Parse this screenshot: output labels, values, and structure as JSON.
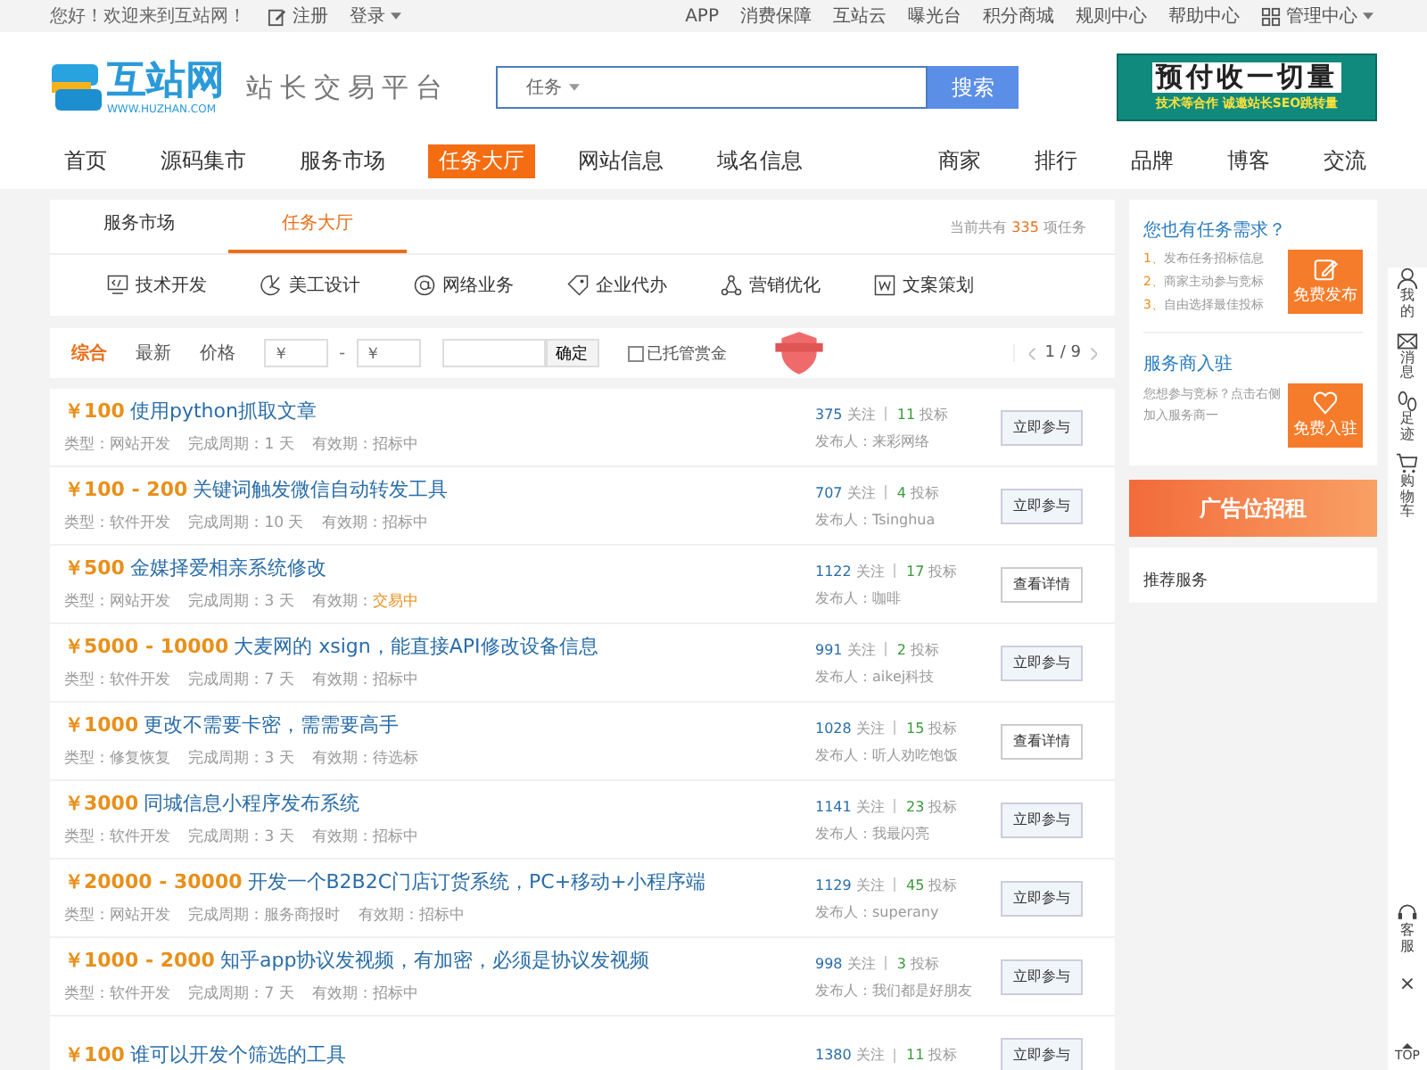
{
  "topbar": {
    "greeting": "您好！欢迎来到互站网！",
    "register": "注册",
    "login": "登录",
    "links": [
      "APP",
      "消费保障",
      "互站云",
      "曝光台",
      "积分商城",
      "规则中心",
      "帮助中心"
    ],
    "admin": "管理中心"
  },
  "header": {
    "logo": "互站网",
    "logo_url": "WWW.HUZHAN.COM",
    "slogan": "站长交易平台",
    "search_category": "任务",
    "search_button": "搜索",
    "ad_title": "预付收一切量",
    "ad_subtitle": "技术等合作 诚邀站长SEO跳转量"
  },
  "nav": {
    "left": [
      {
        "label": "首页",
        "selected": false
      },
      {
        "label": "源码集市",
        "selected": false
      },
      {
        "label": "服务市场",
        "selected": false
      },
      {
        "label": "任务大厅",
        "selected": true
      },
      {
        "label": "网站信息",
        "selected": false
      },
      {
        "label": "域名信息",
        "selected": false
      }
    ],
    "right": [
      "商家",
      "排行",
      "品牌",
      "博客",
      "交流"
    ]
  },
  "tabs": [
    {
      "label": "服务市场",
      "selected": false
    },
    {
      "label": "任务大厅",
      "selected": true
    }
  ],
  "count": {
    "prefix": "当前共有",
    "value": "335",
    "suffix": "项任务"
  },
  "categories": [
    {
      "label": "技术开发"
    },
    {
      "label": "美工设计"
    },
    {
      "label": "网络业务"
    },
    {
      "label": "企业代办"
    },
    {
      "label": "营销优化"
    },
    {
      "label": "文案策划"
    }
  ],
  "filter": {
    "sorts": [
      {
        "label": "综合",
        "selected": true
      },
      {
        "label": "最新",
        "selected": false
      },
      {
        "label": "价格",
        "selected": false
      }
    ],
    "min_placeholder": "￥",
    "dash": "-",
    "max_placeholder": "￥",
    "confirm": "确定",
    "escrow": {
      "label": "已托管赏金",
      "checked": false
    },
    "page": "1 / 9"
  },
  "tasks": [
    {
      "price": "￥100",
      "title": "使用python抓取文章",
      "meta": [
        {
          "label": "类型：网站开发"
        },
        {
          "label": "完成周期：1 天"
        },
        {
          "label": "有效期：",
          "value": "招标中",
          "kind": "normal"
        }
      ],
      "follows": "375",
      "follows_label": "关注",
      "bids": "11",
      "bids_label": "投标",
      "publisher": "发布人：来彩网络",
      "button": {
        "label": "立即参与",
        "kind": "join"
      }
    },
    {
      "price": "￥100 - 200",
      "title": "关键词触发微信自动转发工具",
      "meta": [
        {
          "label": "类型：软件开发"
        },
        {
          "label": "完成周期：10 天"
        },
        {
          "label": "有效期：",
          "value": "招标中",
          "kind": "normal"
        }
      ],
      "follows": "707",
      "follows_label": "关注",
      "bids": "4",
      "bids_label": "投标",
      "publisher": "发布人：Tsinghua",
      "button": {
        "label": "立即参与",
        "kind": "join"
      }
    },
    {
      "price": "￥500",
      "title": "金媒择爱相亲系统修改",
      "meta": [
        {
          "label": "类型：网站开发"
        },
        {
          "label": "完成周期：3 天"
        },
        {
          "label": "有效期：",
          "value": "交易中",
          "kind": "trading"
        }
      ],
      "follows": "1122",
      "follows_label": "关注",
      "bids": "17",
      "bids_label": "投标",
      "publisher": "发布人：咖啡",
      "button": {
        "label": "查看详情",
        "kind": "view"
      }
    },
    {
      "price": "￥5000 - 10000",
      "title": "大麦网的 xsign，能直接API修改设备信息",
      "meta": [
        {
          "label": "类型：软件开发"
        },
        {
          "label": "完成周期：7 天"
        },
        {
          "label": "有效期：",
          "value": "招标中",
          "kind": "normal"
        }
      ],
      "follows": "991",
      "follows_label": "关注",
      "bids": "2",
      "bids_label": "投标",
      "publisher": "发布人：aikej科技",
      "button": {
        "label": "立即参与",
        "kind": "join"
      }
    },
    {
      "price": "￥1000",
      "title": "更改不需要卡密，需需要高手",
      "meta": [
        {
          "label": "类型：修复恢复"
        },
        {
          "label": "完成周期：3 天"
        },
        {
          "label": "有效期：",
          "value": "待选标",
          "kind": "normal"
        }
      ],
      "follows": "1028",
      "follows_label": "关注",
      "bids": "15",
      "bids_label": "投标",
      "publisher": "发布人：听人劝吃饱饭",
      "button": {
        "label": "查看详情",
        "kind": "view"
      }
    },
    {
      "price": "￥3000",
      "title": "同城信息小程序发布系统",
      "meta": [
        {
          "label": "类型：软件开发"
        },
        {
          "label": "完成周期：3 天"
        },
        {
          "label": "有效期：",
          "value": "招标中",
          "kind": "normal"
        }
      ],
      "follows": "1141",
      "follows_label": "关注",
      "bids": "23",
      "bids_label": "投标",
      "publisher": "发布人：我最闪亮",
      "button": {
        "label": "立即参与",
        "kind": "join"
      }
    },
    {
      "price": "￥20000 - 30000",
      "title": "开发一个B2B2C门店订货系统，PC+移动+小程序端",
      "meta": [
        {
          "label": "类型：网站开发"
        },
        {
          "label": "完成周期：服务商报时"
        },
        {
          "label": "有效期：",
          "value": "招标中",
          "kind": "normal"
        }
      ],
      "follows": "1129",
      "follows_label": "关注",
      "bids": "45",
      "bids_label": "投标",
      "publisher": "发布人：superany",
      "button": {
        "label": "立即参与",
        "kind": "join"
      }
    },
    {
      "price": "￥1000 - 2000",
      "title": "知乎app协议发视频，有加密，必须是协议发视频",
      "meta": [
        {
          "label": "类型：软件开发"
        },
        {
          "label": "完成周期：7 天"
        },
        {
          "label": "有效期：",
          "value": "招标中",
          "kind": "normal"
        }
      ],
      "follows": "998",
      "follows_label": "关注",
      "bids": "3",
      "bids_label": "投标",
      "publisher": "发布人：我们都是好朋友",
      "button": {
        "label": "立即参与",
        "kind": "join"
      }
    },
    {
      "price": "￥100",
      "title": "谁可以开发个筛选的工具",
      "follows": "1380",
      "follows_label": "关注",
      "bids": "11",
      "bids_label": "投标",
      "button": {
        "label": "立即参与",
        "kind": "join"
      }
    }
  ],
  "sidebar": {
    "need_title": "您也有任务需求？",
    "steps": [
      {
        "num": "1、",
        "text": "发布任务招标信息"
      },
      {
        "num": "2、",
        "text": "商家主动参与竞标"
      },
      {
        "num": "3、",
        "text": "自由选择最佳投标"
      }
    ],
    "publish_button": "免费发布",
    "provider_title": "服务商入驻",
    "provider_text": "您想参与竞标？点击右侧加入服务商一",
    "join_button": "免费入驻",
    "ad": "广告位招租",
    "recommend": "推荐服务"
  },
  "rail": {
    "items": [
      {
        "label": "我的"
      },
      {
        "label": "消息"
      },
      {
        "label": "足迹"
      },
      {
        "label": "购物车"
      }
    ],
    "service": "客服",
    "close": "×",
    "top": "TOP"
  }
}
